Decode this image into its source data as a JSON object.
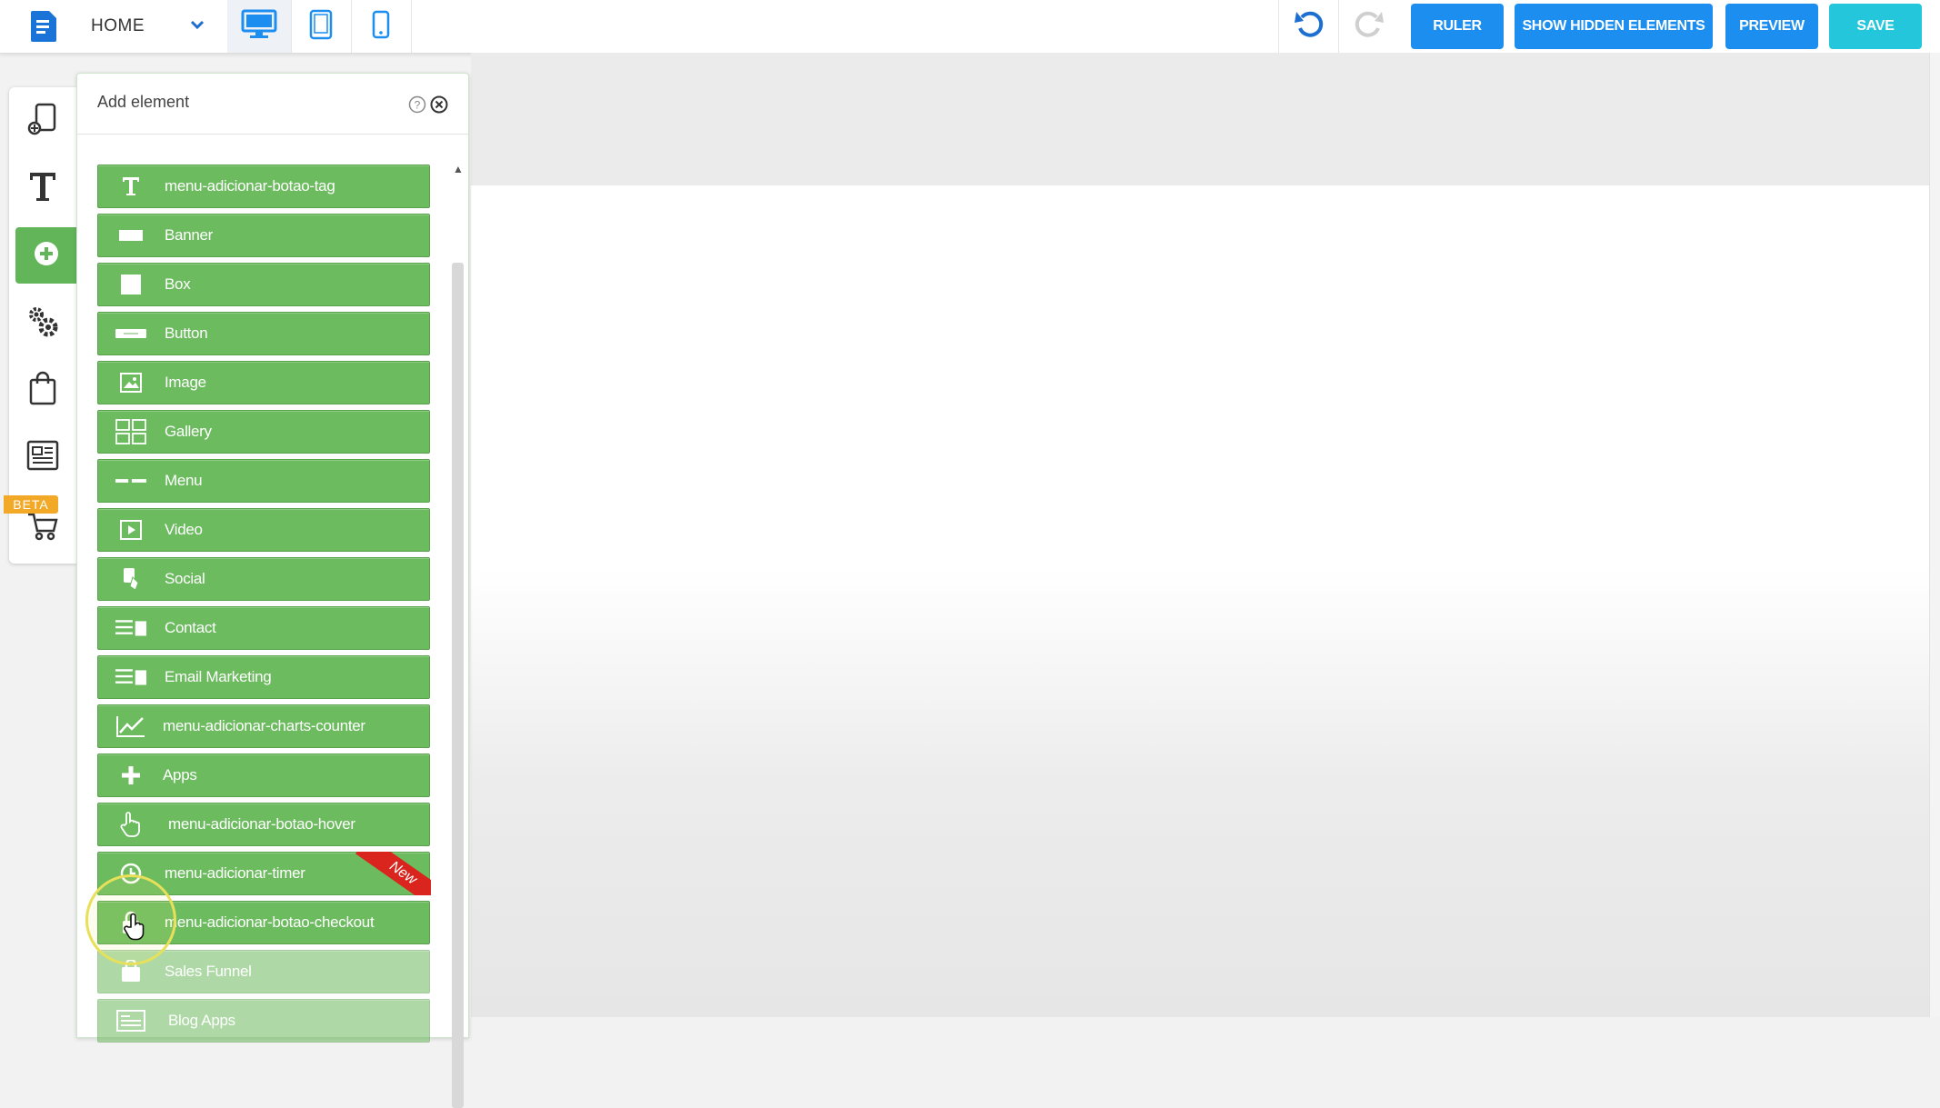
{
  "header": {
    "page_selector": "HOME",
    "buttons": {
      "ruler": "RULER",
      "show_hidden": "SHOW HIDDEN ELEMENTS",
      "preview": "PREVIEW",
      "save": "SAVE"
    }
  },
  "sidebar": {
    "beta_badge": "BETA"
  },
  "panel": {
    "title": "Add element",
    "items": [
      {
        "label": "menu-adicionar-botao-tag",
        "icon": "text-icon"
      },
      {
        "label": "Banner",
        "icon": "banner-icon"
      },
      {
        "label": "Box",
        "icon": "box-icon"
      },
      {
        "label": "Button",
        "icon": "button-icon"
      },
      {
        "label": "Image",
        "icon": "image-icon"
      },
      {
        "label": "Gallery",
        "icon": "gallery-icon"
      },
      {
        "label": "Menu",
        "icon": "menu-icon"
      },
      {
        "label": "Video",
        "icon": "video-icon"
      },
      {
        "label": "Social",
        "icon": "social-icon"
      },
      {
        "label": "Contact",
        "icon": "contact-icon"
      },
      {
        "label": "Email Marketing",
        "icon": "email-marketing-icon"
      },
      {
        "label": "menu-adicionar-charts-counter",
        "icon": "chart-icon"
      },
      {
        "label": "Apps",
        "icon": "plus-icon"
      },
      {
        "label": "menu-adicionar-botao-hover",
        "icon": "hand-pointer-icon"
      },
      {
        "label": "menu-adicionar-timer",
        "icon": "clock-icon",
        "ribbon": "New"
      },
      {
        "label": "menu-adicionar-botao-checkout",
        "icon": "lock-icon"
      },
      {
        "label": "Sales Funnel",
        "icon": "funnel-icon"
      },
      {
        "label": "Blog Apps",
        "icon": "blog-icon"
      }
    ]
  },
  "colors": {
    "primary_button": "#1c8ef0",
    "save_button": "#24c6dc",
    "element_green": "#6cbb5f",
    "beta_orange": "#f3a928",
    "new_ribbon_red": "#d9251d"
  }
}
